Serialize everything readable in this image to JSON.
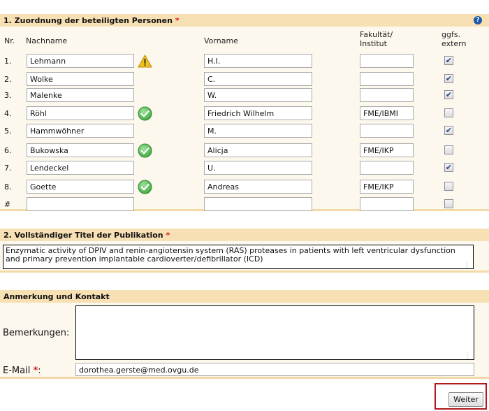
{
  "section1": {
    "title": "1. Zuordnung der beteiligten Personen",
    "required_mark": "*",
    "help_label": "?",
    "columns": {
      "nr": "Nr.",
      "nachname": "Nachname",
      "vorname": "Vorname",
      "fakultaet_line1": "Fakultät/",
      "fakultaet_line2": "Institut",
      "extern_line1": "ggfs.",
      "extern_line2": "extern"
    },
    "rows": [
      {
        "nr": "1.",
        "nachname": "Lehmann",
        "vorname": "H.I.",
        "fakultaet": "",
        "extern": true,
        "status": "warning"
      },
      {
        "nr": "2.",
        "nachname": "Wolke",
        "vorname": "C.",
        "fakultaet": "",
        "extern": true,
        "status": ""
      },
      {
        "nr": "3.",
        "nachname": "Malenke",
        "vorname": "W.",
        "fakultaet": "",
        "extern": true,
        "status": ""
      },
      {
        "nr": "4.",
        "nachname": "Röhl",
        "vorname": "Friedrich Wilhelm",
        "fakultaet": "FME/IBMI",
        "extern": false,
        "status": "ok"
      },
      {
        "nr": "5.",
        "nachname": "Hammwöhner",
        "vorname": "M.",
        "fakultaet": "",
        "extern": true,
        "status": ""
      },
      {
        "nr": "6.",
        "nachname": "Bukowska",
        "vorname": "Alicja",
        "fakultaet": "FME/IKP",
        "extern": false,
        "status": "ok"
      },
      {
        "nr": "7.",
        "nachname": "Lendeckel",
        "vorname": "U.",
        "fakultaet": "",
        "extern": true,
        "status": ""
      },
      {
        "nr": "8.",
        "nachname": "Goette",
        "vorname": "Andreas",
        "fakultaet": "FME/IKP",
        "extern": false,
        "status": "ok"
      },
      {
        "nr": "#",
        "nachname": "",
        "vorname": "",
        "fakultaet": "",
        "extern": false,
        "status": ""
      }
    ]
  },
  "section2": {
    "title": "2. Vollständiger Titel der Publikation",
    "required_mark": "*",
    "title_text": "Enzymatic activity of DPIV and renin-angiotensin system (RAS) proteases in patients with left ventricular dysfunction and primary prevention implantable cardioverter/defibrillator (ICD)"
  },
  "section3": {
    "title": "Anmerkung und Kontakt",
    "bemerkungen_label": "Bemerkungen:",
    "bemerkungen_value": "",
    "email_label": "E-Mail",
    "email_required_mark": "*",
    "email_colon": ":",
    "email_value": "dorothea.gerste@med.ovgu.de"
  },
  "footer": {
    "weiter_label": "Weiter"
  },
  "icons": {
    "warning": "warning-icon",
    "ok": "check-circle-icon",
    "help": "help-icon"
  },
  "colors": {
    "header_bg": "#f7e0b4",
    "section_bg": "#fdf8ee",
    "required": "#d62020",
    "ok_green": "#5cb85c",
    "warning_yellow": "#f2c01e",
    "button_highlight": "#b01a1a"
  }
}
